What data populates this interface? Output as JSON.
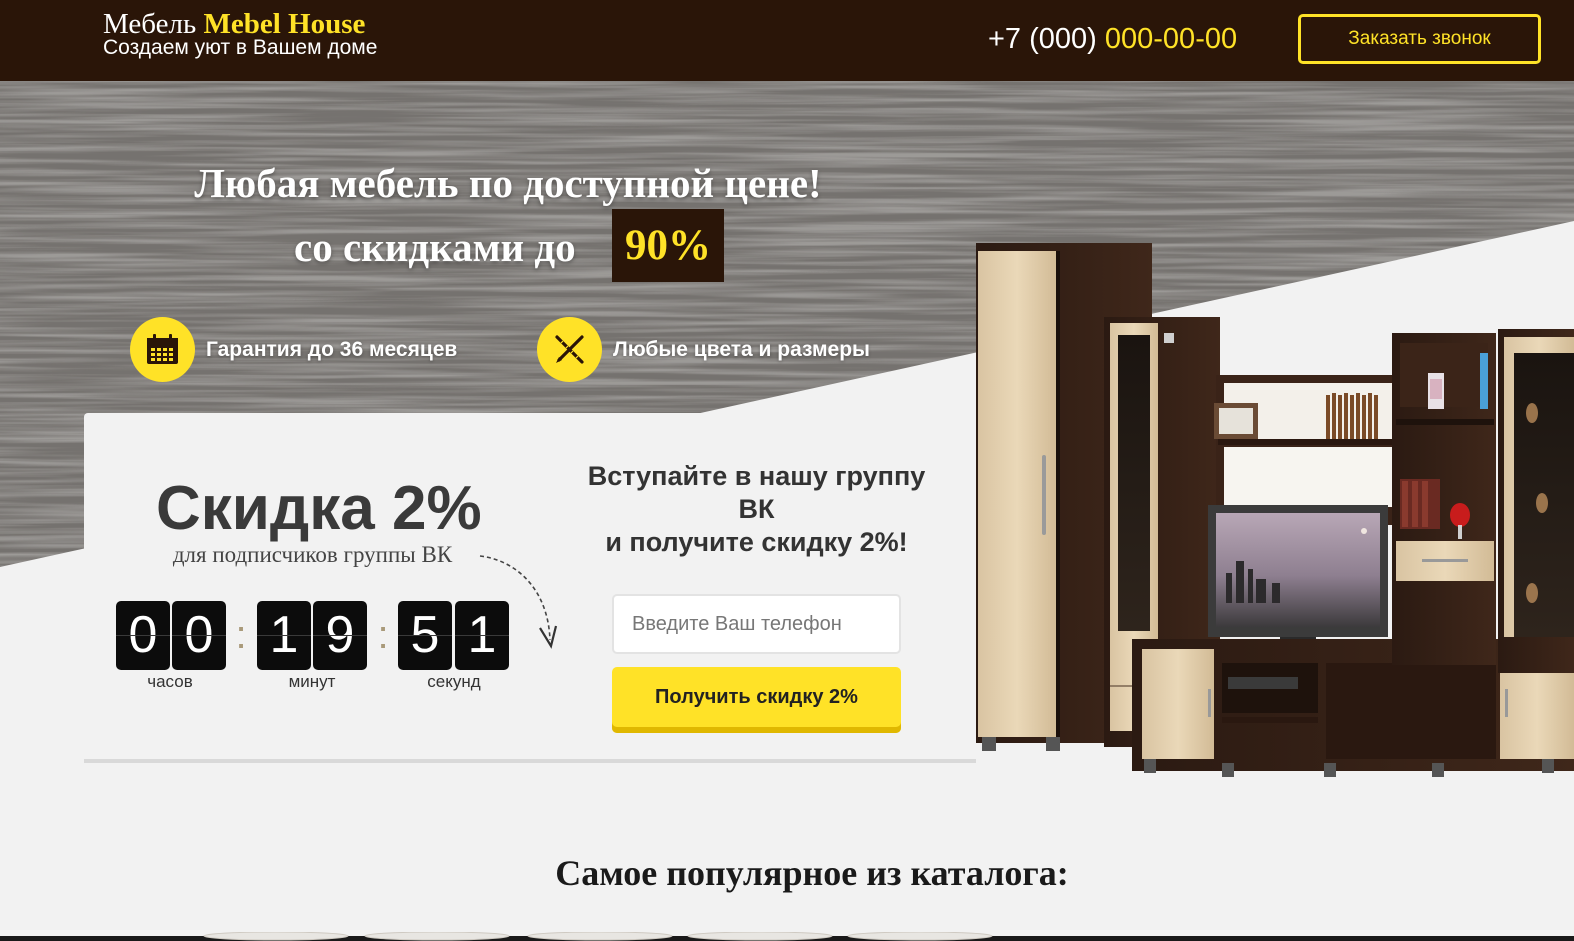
{
  "header": {
    "logo_prefix": "Мебель",
    "logo_brand": "Mebel House",
    "tagline": "Создаем уют в Вашем доме",
    "phone_prefix": "+7 (000)",
    "phone_number": "000-00-00",
    "callback_label": "Заказать звонок"
  },
  "hero": {
    "title_line1": "Любая мебель по доступной цене!",
    "title_line2": "со скидками до",
    "discount": "90%",
    "features": [
      {
        "icon": "calendar-icon",
        "text": "Гарантия до 36 месяцев"
      },
      {
        "icon": "ruler-pencil-icon",
        "text": "Любые цвета и размеры"
      }
    ]
  },
  "promo": {
    "title": "Скидка 2%",
    "subtitle": "для подписчиков группы ВК",
    "timer": {
      "hours": [
        "0",
        "0"
      ],
      "minutes": [
        "1",
        "9"
      ],
      "seconds": [
        "5",
        "1"
      ],
      "separator": ":",
      "hours_label": "часов",
      "minutes_label": "минут",
      "seconds_label": "секунд"
    },
    "vk_line1": "Вступайте в нашу группу ВК",
    "vk_line2": "и получите скидку 2%!",
    "phone_placeholder": "Введите Ваш телефон",
    "submit_label": "Получить скидку 2%"
  },
  "catalog": {
    "title": "Самое популярное из каталога:"
  },
  "colors": {
    "header_bg": "#2a1508",
    "accent_yellow": "#ffe227",
    "page_bg": "#f2f2f2"
  }
}
